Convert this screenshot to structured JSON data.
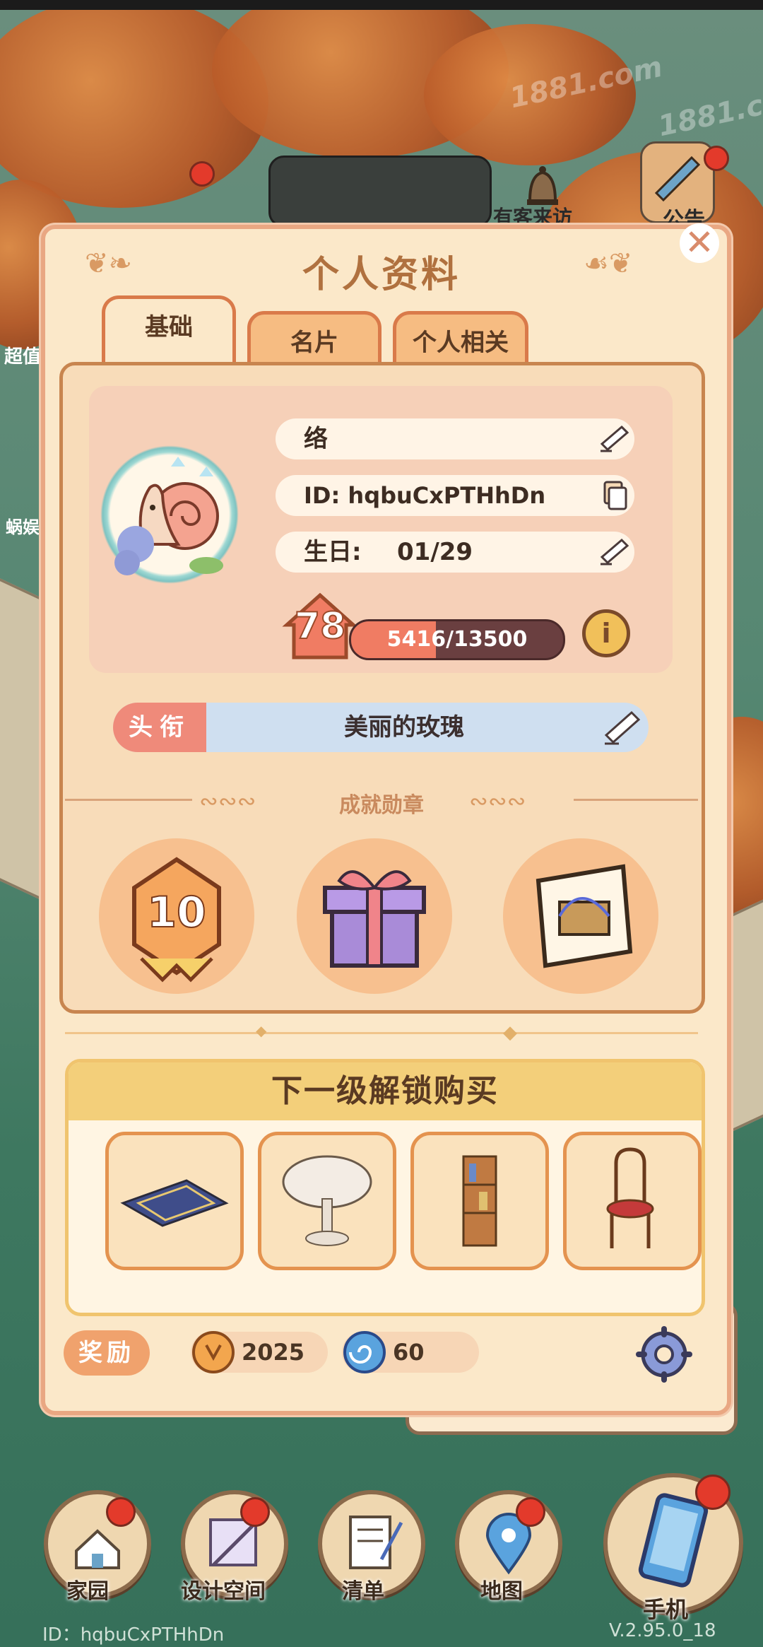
{
  "background": {
    "hud_label_visitor": "有客来访",
    "hud_label_notice": "公告",
    "hud_label_left1": "超值",
    "hud_label_left2": "蜗娱",
    "watermark": "1881.com"
  },
  "modal": {
    "title": "个人资料",
    "close_label": "✕",
    "tabs": [
      {
        "label": "基础",
        "active": true
      },
      {
        "label": "名片",
        "active": false
      },
      {
        "label": "个人相关",
        "active": false
      }
    ]
  },
  "profile": {
    "name": "络",
    "id_text": "ID: hqbuCxPTHhDn",
    "birthday_label": "生日:",
    "birthday_value": "01/29",
    "level": "78",
    "exp_current": 5416,
    "exp_max": 13500,
    "exp_text": "5416/13500",
    "info_symbol": "i"
  },
  "title_row": {
    "tag": "头衔",
    "value": "美丽的玫瑰"
  },
  "achievements": {
    "heading": "成就勋章",
    "badges": [
      {
        "icon": "level-10-badge-icon",
        "text": "10"
      },
      {
        "icon": "gift-box-badge-icon"
      },
      {
        "icon": "scroll-box-badge-icon"
      }
    ]
  },
  "unlock": {
    "heading": "下一级解锁购买",
    "items": [
      {
        "icon": "rug-icon"
      },
      {
        "icon": "round-table-icon"
      },
      {
        "icon": "bookshelf-icon"
      },
      {
        "icon": "chair-icon"
      }
    ]
  },
  "rewards": {
    "label": "奖励",
    "coins": "2025",
    "gems": "60"
  },
  "bottom_nav": {
    "items": [
      {
        "label": "家园",
        "icon": "home-icon"
      },
      {
        "label": "设计空间",
        "icon": "design-ruler-icon"
      },
      {
        "label": "清单",
        "icon": "list-quill-icon"
      },
      {
        "label": "地图",
        "icon": "map-pin-icon"
      },
      {
        "label": "手机",
        "icon": "phone-icon"
      }
    ],
    "footer_id": "ID：hqbuCxPTHhDn",
    "version": "V.2.95.0_18"
  },
  "colors": {
    "modal_bg": "#fbe8c9",
    "accent": "#e9a782",
    "title_text": "#b0713f",
    "exp_fill": "#f07c63"
  }
}
